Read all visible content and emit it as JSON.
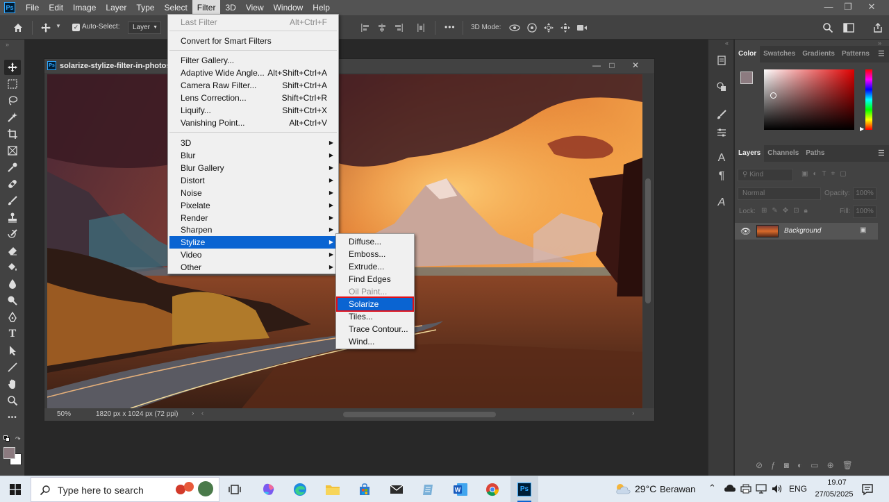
{
  "menubar": {
    "logo": "Ps",
    "items": [
      "File",
      "Edit",
      "Image",
      "Layer",
      "Type",
      "Select",
      "Filter",
      "3D",
      "View",
      "Window",
      "Help"
    ],
    "active": "Filter"
  },
  "options": {
    "auto_select_label": "Auto-Select:",
    "auto_select_value": "Layer",
    "mode_3d_label": "3D Mode:",
    "more": "•••"
  },
  "document": {
    "title": "solarize-stylize-filter-in-photosh",
    "zoom": "50%",
    "size_info": "1820 px x 1024 px (72 ppi)"
  },
  "filter_menu": {
    "last_filter": "Last Filter",
    "last_filter_sc": "Alt+Ctrl+F",
    "convert_smart": "Convert for Smart Filters",
    "gallery": "Filter Gallery...",
    "adaptive": "Adaptive Wide Angle...",
    "adaptive_sc": "Alt+Shift+Ctrl+A",
    "camera_raw": "Camera Raw Filter...",
    "camera_raw_sc": "Shift+Ctrl+A",
    "lens": "Lens Correction...",
    "lens_sc": "Shift+Ctrl+R",
    "liquify": "Liquify...",
    "liquify_sc": "Shift+Ctrl+X",
    "vanishing": "Vanishing Point...",
    "vanishing_sc": "Alt+Ctrl+V",
    "sub": [
      "3D",
      "Blur",
      "Blur Gallery",
      "Distort",
      "Noise",
      "Pixelate",
      "Render",
      "Sharpen",
      "Stylize",
      "Video",
      "Other"
    ],
    "highlighted": "Stylize"
  },
  "stylize_menu": {
    "items": [
      "Diffuse...",
      "Emboss...",
      "Extrude...",
      "Find Edges",
      "Oil Paint...",
      "Solarize",
      "Tiles...",
      "Trace Contour...",
      "Wind..."
    ],
    "disabled": "Oil Paint...",
    "highlighted": "Solarize",
    "highlight_color": "#0a64d2",
    "outline_color": "#e0101a"
  },
  "color_panel": {
    "tabs": [
      "Color",
      "Swatches",
      "Gradients",
      "Patterns"
    ],
    "active": "Color"
  },
  "layers_panel": {
    "tabs": [
      "Layers",
      "Channels",
      "Paths"
    ],
    "active": "Layers",
    "kind": "Kind",
    "blend": "Normal",
    "opacity_label": "Opacity:",
    "opacity_value": "100%",
    "lock_label": "Lock:",
    "fill_label": "Fill:",
    "fill_value": "100%",
    "layer_name": "Background"
  },
  "taskbar": {
    "search_placeholder": "Type here to search",
    "temperature": "29°C",
    "weather": "Berawan",
    "language": "ENG",
    "time": "19.07",
    "date": "27/05/2025"
  },
  "colors": {
    "ps_blue": "#31a8ff",
    "menu_highlight": "#0a64d2",
    "foreground_swatch": "#8c7b80"
  }
}
